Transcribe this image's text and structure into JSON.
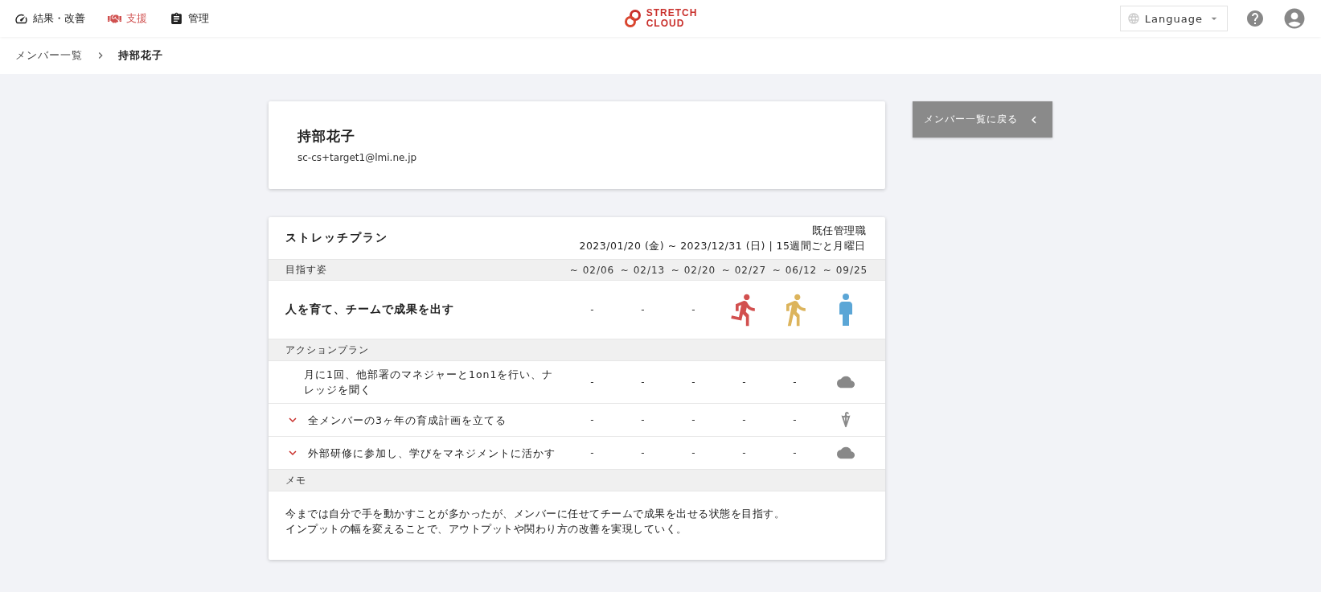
{
  "nav": [
    {
      "label": "結果・改善",
      "kind": "gauge",
      "selected": false
    },
    {
      "label": "支援",
      "kind": "handshake",
      "selected": true
    },
    {
      "label": "管理",
      "kind": "clipboard",
      "selected": false
    }
  ],
  "logo": {
    "line1": "STRETCH",
    "line2": "CLOUD"
  },
  "language": {
    "label": "Language"
  },
  "breadcrumb": [
    {
      "label": "メンバー一覧",
      "current": false
    },
    {
      "label": "持部花子",
      "current": true
    }
  ],
  "profile": {
    "name": "持部花子",
    "email": "sc-cs+target1@lmi.ne.jp"
  },
  "back_button": {
    "label": "メンバー一覧に戻る"
  },
  "plan": {
    "title": "ストレッチプラン",
    "role": "既任管理職",
    "period": "2023/01/20 (金) ~ 2023/12/31 (日) | 15週間ごと月曜日",
    "goal_section": "目指す姿",
    "columns": [
      "~ 02/06",
      "~ 02/13",
      "~ 02/20",
      "~ 02/27",
      "~ 06/12",
      "~ 09/25"
    ],
    "goal": {
      "text": "人を育て、チームで成果を出す",
      "cells": [
        {
          "kind": "dash",
          "text": "-"
        },
        {
          "kind": "dash",
          "text": "-"
        },
        {
          "kind": "dash",
          "text": "-"
        },
        {
          "kind": "run"
        },
        {
          "kind": "walk"
        },
        {
          "kind": "stand"
        }
      ]
    },
    "action_section": "アクションプラン",
    "actions": [
      {
        "text": "月に1回、他部署のマネジャーと1on1を行い、ナレッジを聞く",
        "toggle": false,
        "cells": [
          {
            "kind": "dash",
            "text": "-"
          },
          {
            "kind": "dash",
            "text": "-"
          },
          {
            "kind": "dash",
            "text": "-"
          },
          {
            "kind": "dash",
            "text": "-"
          },
          {
            "kind": "dash",
            "text": "-"
          },
          {
            "kind": "cloud"
          }
        ]
      },
      {
        "text": "全メンバーの3ヶ年の育成計画を立てる",
        "toggle": true,
        "cells": [
          {
            "kind": "dash",
            "text": "-"
          },
          {
            "kind": "dash",
            "text": "-"
          },
          {
            "kind": "dash",
            "text": "-"
          },
          {
            "kind": "dash",
            "text": "-"
          },
          {
            "kind": "dash",
            "text": "-"
          },
          {
            "kind": "umbrella"
          }
        ]
      },
      {
        "text": "外部研修に参加し、学びをマネジメントに活かす",
        "toggle": true,
        "cells": [
          {
            "kind": "dash",
            "text": "-"
          },
          {
            "kind": "dash",
            "text": "-"
          },
          {
            "kind": "dash",
            "text": "-"
          },
          {
            "kind": "dash",
            "text": "-"
          },
          {
            "kind": "dash",
            "text": "-"
          },
          {
            "kind": "cloud"
          }
        ]
      }
    ],
    "memo_section": "メモ",
    "memo": [
      "今までは自分で手を動かすことが多かったが、メンバーに任せてチームで成果を出せる状態を目指す。",
      "インプットの幅を変えることで、アウトプットや関わり方の改善を実現していく。"
    ]
  }
}
